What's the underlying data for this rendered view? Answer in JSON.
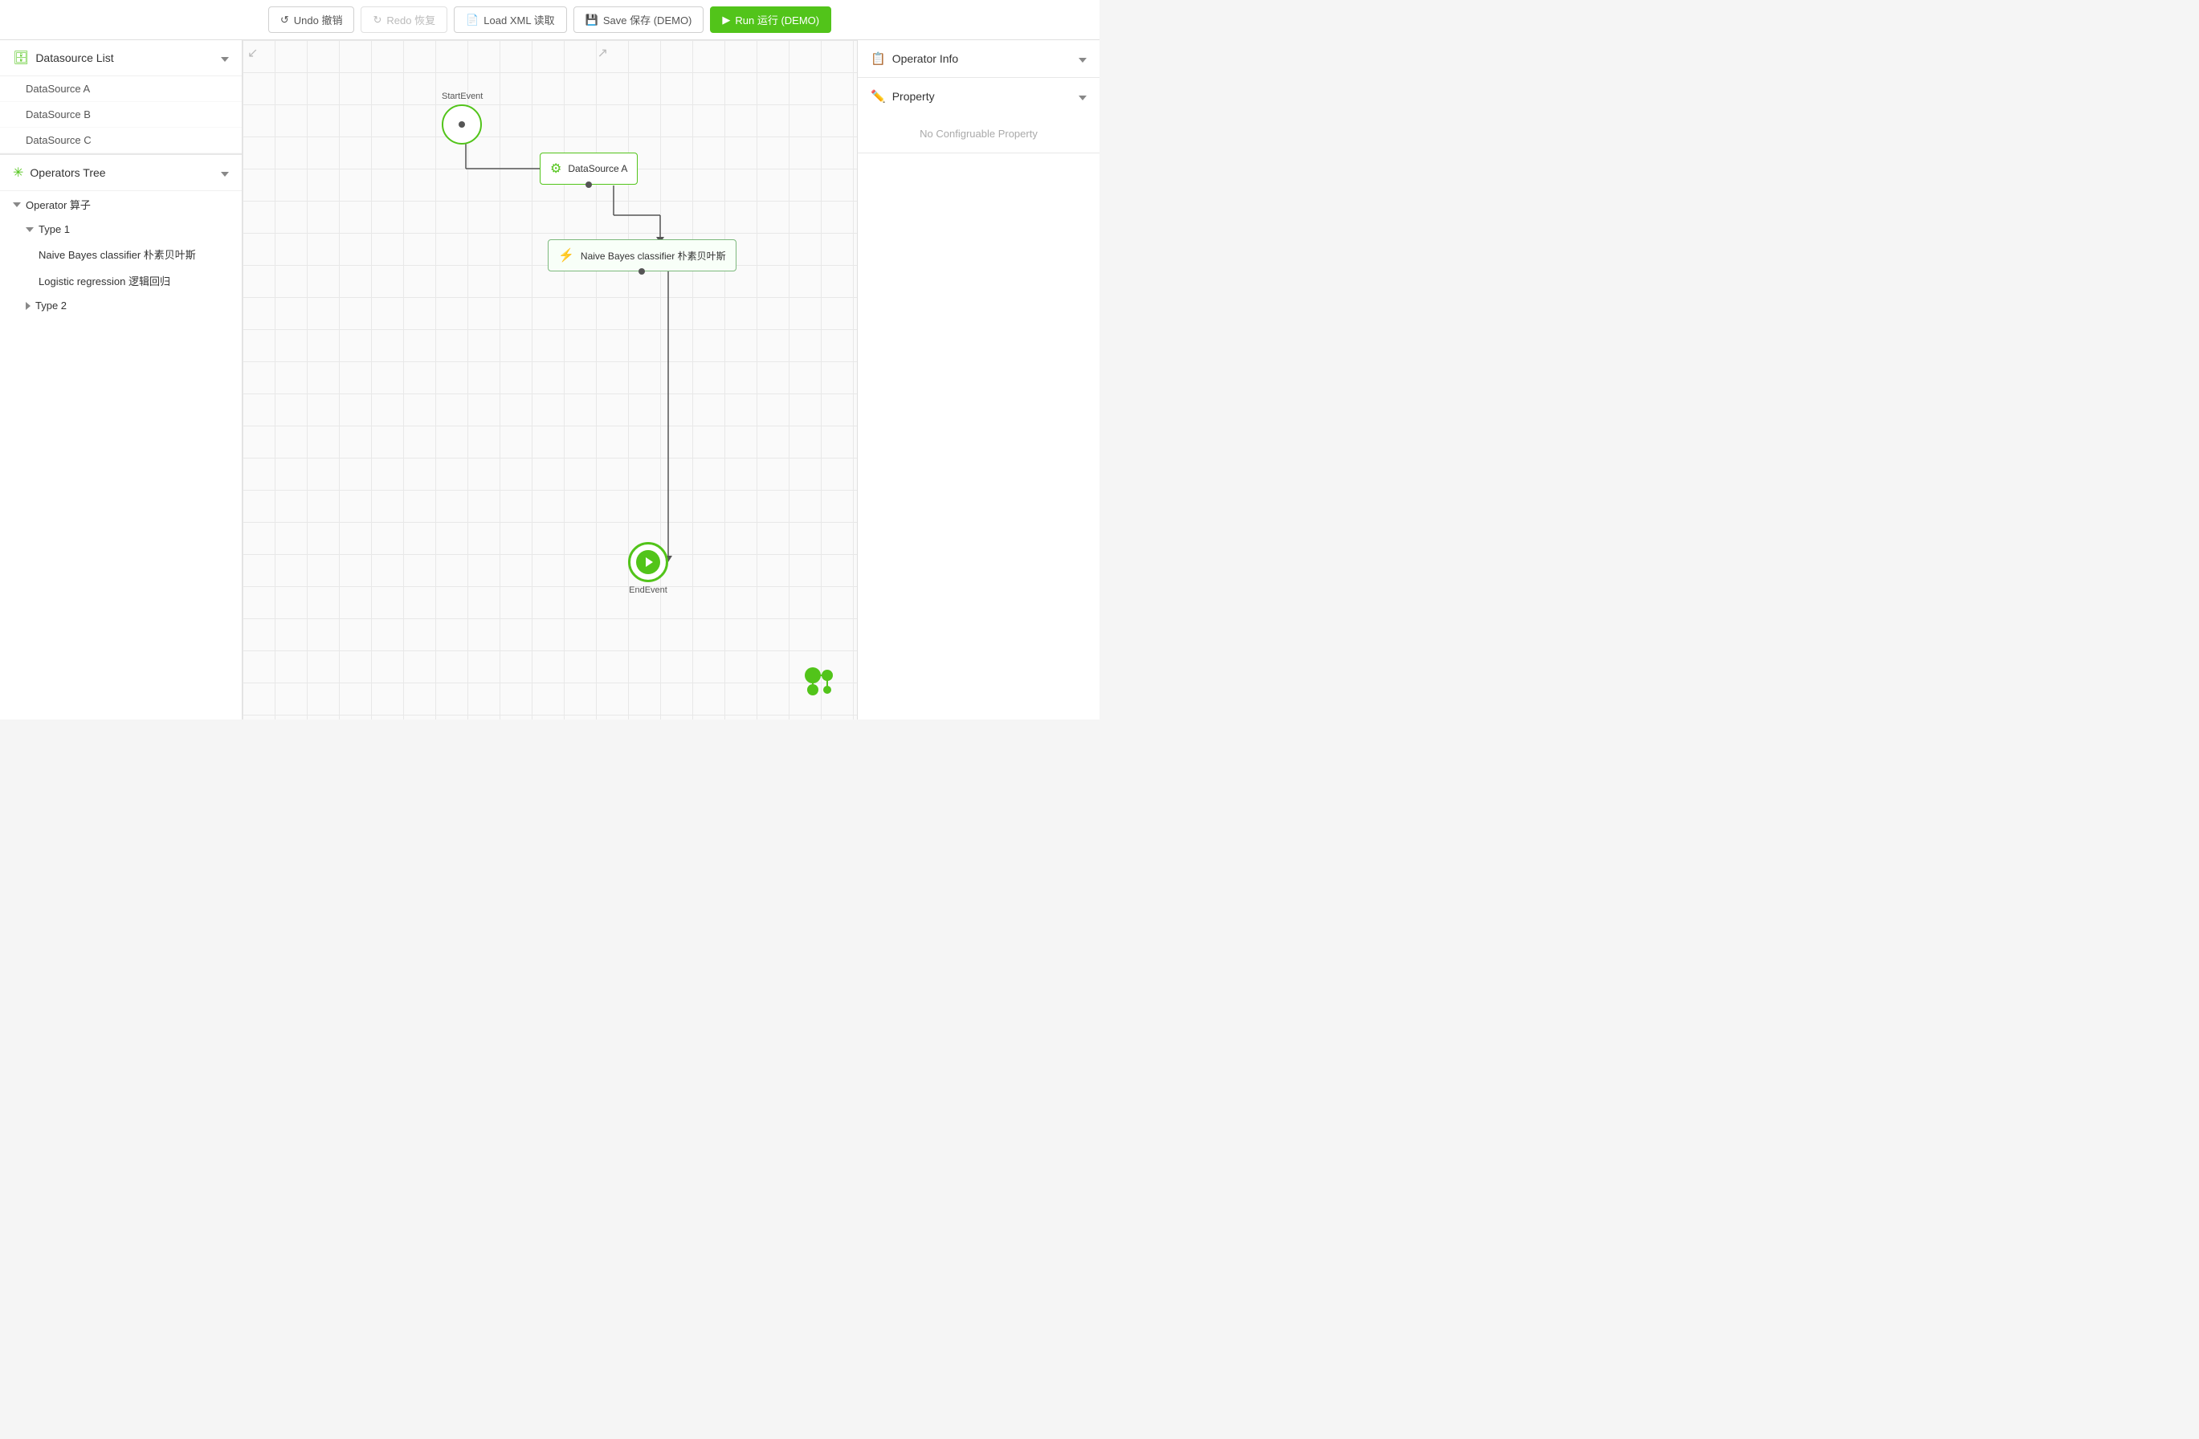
{
  "toolbar": {
    "undo_label": "Undo 撤销",
    "redo_label": "Redo 恢复",
    "load_label": "Load XML 读取",
    "save_label": "Save 保存 (DEMO)",
    "run_label": "Run 运行 (DEMO)"
  },
  "sidebar": {
    "datasource_header": "Datasource List",
    "datasource_items": [
      "DataSource A",
      "DataSource B",
      "DataSource C"
    ],
    "tree_header": "Operators Tree",
    "tree_items": [
      {
        "label": "Operator 算子",
        "level": 0,
        "expanded": true,
        "type": "operator"
      },
      {
        "label": "Type 1",
        "level": 1,
        "expanded": true,
        "type": "type"
      },
      {
        "label": "Naive Bayes classifier 朴素贝叶斯",
        "level": 2,
        "type": "leaf"
      },
      {
        "label": "Logistic regression 逻辑回归",
        "level": 2,
        "type": "leaf"
      },
      {
        "label": "Type 2",
        "level": 1,
        "expanded": false,
        "type": "type"
      }
    ]
  },
  "canvas": {
    "start_label": "StartEvent",
    "datasource_label": "DataSource A",
    "classifier_label": "Naive Bayes classifier 朴素贝叶斯",
    "end_label": "EndEvent"
  },
  "right_panel": {
    "operator_info_label": "Operator Info",
    "property_label": "Property",
    "no_config_label": "No Configruable Property"
  }
}
